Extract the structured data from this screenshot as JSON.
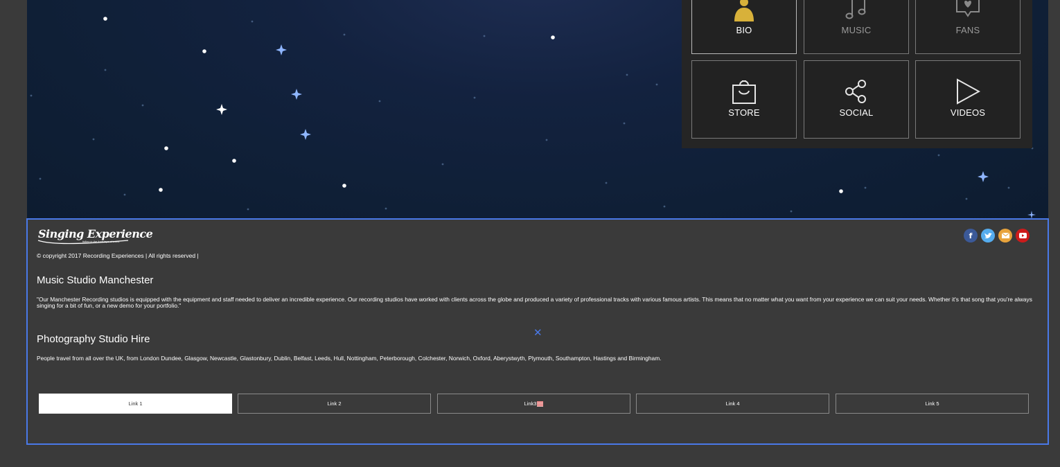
{
  "tiles": [
    {
      "label": "BIO",
      "icon": "person-icon"
    },
    {
      "label": "MUSIC",
      "icon": "music-note-icon"
    },
    {
      "label": "FANS",
      "icon": "heart-bubble-icon"
    },
    {
      "label": "STORE",
      "icon": "shopping-bag-icon"
    },
    {
      "label": "SOCIAL",
      "icon": "share-icon"
    },
    {
      "label": "VIDEOS",
      "icon": "play-icon"
    }
  ],
  "footer": {
    "logo_text": "Singing Experience",
    "logo_tagline": "follow in the footsteps of icons",
    "copyright": "© copyright 2017 Recording Experiences | All rights reserved |",
    "socials": [
      {
        "icon": "facebook-icon",
        "color": "#3b5998"
      },
      {
        "icon": "twitter-icon",
        "color": "#55acee"
      },
      {
        "icon": "email-icon",
        "color": "#e8a33c"
      },
      {
        "icon": "youtube-icon",
        "color": "#cc1b1b"
      }
    ],
    "section1": {
      "title": "Music Studio Manchester",
      "text": "\"Our Manchester Recording studios is equipped with the equipment and staff needed to deliver an incredible experience. Our recording studios have worked with clients across the globe and produced a variety of professional tracks with various famous artists. This means that no matter what you want from your experience we can suit your needs. Whether it's that song that you're always singing for a bit of fun, or a new demo for your portfolio.\""
    },
    "section2": {
      "title": "Photography Studio Hire",
      "text": "People travel from all over the UK, from London Dundee, Glasgow, Newcastle, Glastonbury, Dublin, Belfast, Leeds, Hull, Nottingham, Peterborough, Colchester, Norwich, Oxford, Aberystwyth, Plymouth, Southampton, Hastings and Birmingham."
    },
    "close_glyph": "✕",
    "links": [
      "Link 1",
      "Link 2",
      "Link3",
      "Link 4",
      "Link 5"
    ]
  },
  "colors": {
    "accent_blue": "#4a79e8",
    "bio_gold": "#d8b13a"
  }
}
